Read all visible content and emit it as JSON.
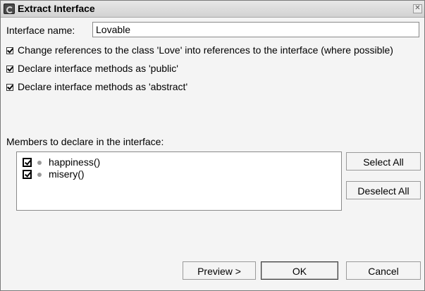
{
  "window": {
    "title": "Extract Interface",
    "close_glyph": "✕"
  },
  "interface_name": {
    "label": "Interface name:",
    "value": "Lovable"
  },
  "options": [
    {
      "label": "Change references to the class 'Love' into references to the interface (where possible)",
      "checked": true
    },
    {
      "label": "Declare interface methods as 'public'",
      "checked": true
    },
    {
      "label": "Declare interface methods as 'abstract'",
      "checked": true
    }
  ],
  "members": {
    "label": "Members to declare in the interface:",
    "items": [
      {
        "name": "happiness()",
        "checked": true,
        "icon": "method-dot-icon"
      },
      {
        "name": "misery()",
        "checked": true,
        "icon": "method-dot-icon"
      }
    ]
  },
  "side_buttons": {
    "select_all": "Select All",
    "deselect_all": "Deselect All"
  },
  "footer_buttons": {
    "preview": "Preview >",
    "ok": "OK",
    "cancel": "Cancel"
  }
}
